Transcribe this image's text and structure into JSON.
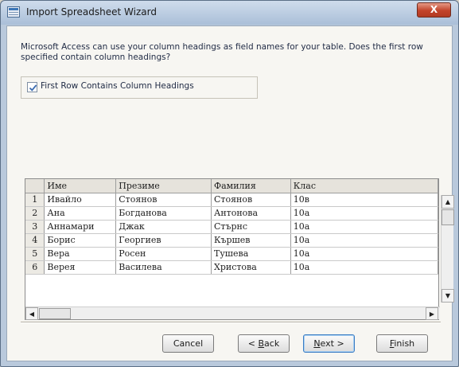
{
  "window": {
    "title": "Import Spreadsheet Wizard",
    "close_glyph": "X"
  },
  "description": "Microsoft Access can use your column headings as field names for your table. Does the first row specified contain column headings?",
  "checkbox": {
    "label": "First Row Contains Column Headings",
    "checked": true
  },
  "grid": {
    "headers": [
      "Име",
      "Презиме",
      "Фамилия",
      "Клас"
    ],
    "rows": [
      {
        "num": "1",
        "cells": [
          "Ивайло",
          "Стоянов",
          "Стоянов",
          "10в"
        ]
      },
      {
        "num": "2",
        "cells": [
          "Ана",
          "Богданова",
          "Антонова",
          "10а"
        ]
      },
      {
        "num": "3",
        "cells": [
          "Аннамари",
          "Джак",
          "Стърнс",
          "10а"
        ]
      },
      {
        "num": "4",
        "cells": [
          "Борис",
          "Георгиев",
          "Кършев",
          "10а"
        ]
      },
      {
        "num": "5",
        "cells": [
          "Вера",
          "Росен",
          "Тушева",
          "10а"
        ]
      },
      {
        "num": "6",
        "cells": [
          "Верея",
          "Василева",
          "Христова",
          "10а"
        ]
      }
    ]
  },
  "buttons": {
    "cancel": "Cancel",
    "back_prefix": "< ",
    "back_ul": "B",
    "back_rest": "ack",
    "next_ul": "N",
    "next_rest": "ext >",
    "finish_ul": "F",
    "finish_rest": "inish"
  },
  "scroll": {
    "up_glyph": "▲",
    "down_glyph": "▼",
    "left_glyph": "◀",
    "right_glyph": "▶"
  }
}
